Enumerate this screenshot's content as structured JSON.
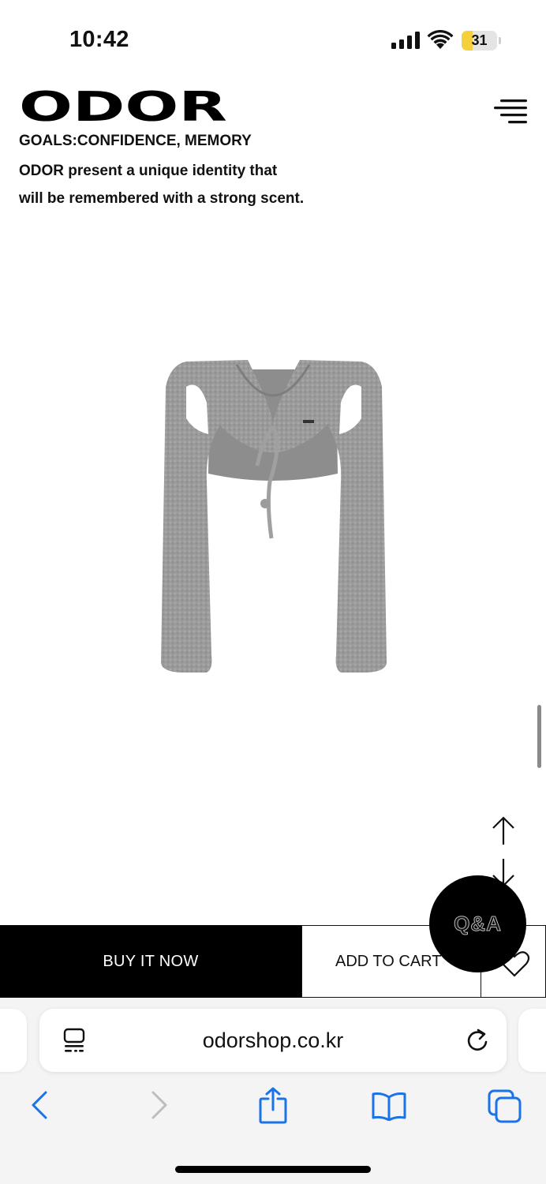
{
  "status_bar": {
    "time": "10:42",
    "battery_level": "31",
    "battery_fraction": 0.31,
    "battery_color": "#f5d03a",
    "icons": [
      "signal-icon",
      "wifi-icon",
      "battery-icon"
    ]
  },
  "header": {
    "brand": "ODOR",
    "menu_icon": "hamburger-menu-icon",
    "tagline": "GOALS:CONFIDENCE, MEMORY",
    "description_line1": "ODOR present a unique identity that",
    "description_line2": "will be remembered with a strong scent."
  },
  "product": {
    "image_icon": "cropped-cardigan-image"
  },
  "scroll_controls": {
    "up_icon": "arrow-up-icon",
    "down_icon": "arrow-down-icon"
  },
  "purchase_bar": {
    "buy_now_label": "BUY IT NOW",
    "add_to_cart_label": "ADD TO CART",
    "wishlist_icon": "heart-icon",
    "qa_label": "Q&A"
  },
  "safari": {
    "url": "odorshop.co.kr",
    "reader_icon": "reader-mode-icon",
    "reload_icon": "reload-icon",
    "accent_color": "#1a73e8",
    "toolbar": [
      "back-icon",
      "forward-icon",
      "share-icon",
      "bookmarks-icon",
      "tabs-icon"
    ]
  }
}
